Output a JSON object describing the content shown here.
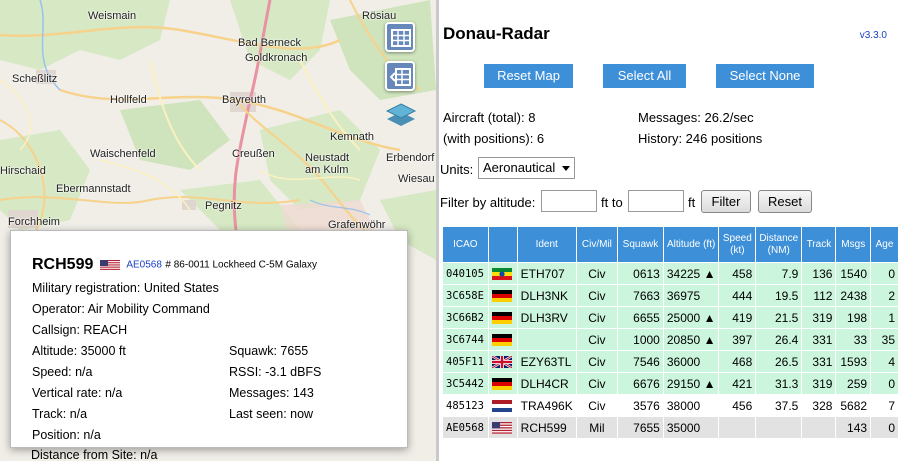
{
  "map": {
    "places": [
      "Weismain",
      "Rösiau",
      "Bad Berneck",
      "Goldkronach",
      "Scheßlitz",
      "Hollfeld",
      "Bayreuth",
      "Kemnath",
      "Waischenfeld",
      "Creußen",
      "Neustadt am Kulm",
      "Erbendorf",
      "Hirschaid",
      "Ebermannstadt",
      "Pegnitz",
      "Wiesau",
      "Forchheim",
      "Grafenwöhr"
    ]
  },
  "popup": {
    "callsign": "RCH599",
    "icao": "AE0568",
    "registration_line": "# 86-0011 Lockheed C-5M Galaxy",
    "military_registration": "Military registration: United States",
    "operator": "Operator: Air Mobility Command",
    "callsign_line": "Callsign: REACH",
    "altitude": "Altitude: 35000 ft",
    "squawk": "Squawk: 7655",
    "speed": "Speed: n/a",
    "rssi": "RSSI: -3.1 dBFS",
    "vertical_rate": "Vertical rate: n/a",
    "messages": "Messages: 143",
    "track": "Track: n/a",
    "last_seen": "Last seen: now",
    "position": "Position: n/a",
    "distance": "Distance from Site: n/a"
  },
  "sidebar": {
    "title": "Donau-Radar",
    "version": "v3.3.0",
    "buttons": {
      "reset_map": "Reset Map",
      "select_all": "Select All",
      "select_none": "Select None"
    },
    "aircraft_total": "Aircraft (total): 8",
    "with_positions": "(with positions): 6",
    "messages": "Messages: 26.2/sec",
    "history": "History: 246 positions",
    "units_label": "Units:",
    "units_value": "Aeronautical",
    "filter_label": "Filter by altitude:",
    "ft_to": "ft to",
    "ft": "ft",
    "filter_button": "Filter",
    "reset_button": "Reset"
  },
  "table": {
    "headers": [
      "ICAO",
      "",
      "Ident",
      "Civ/Mil",
      "Squawk",
      "Altitude (ft)",
      "Speed (kt)",
      "Distance (NM)",
      "Track",
      "Msgs",
      "Age"
    ],
    "rows": [
      {
        "icao": "040105",
        "flag": "ethiopia",
        "ident": "ETH707",
        "civmil": "Civ",
        "squawk": "0613",
        "altitude": "34225 ▲",
        "speed": "458",
        "distance": "7.9",
        "track": "136",
        "msgs": "1540",
        "age": "0",
        "kind": "pos"
      },
      {
        "icao": "3C658E",
        "flag": "germany",
        "ident": "DLH3NK",
        "civmil": "Civ",
        "squawk": "7663",
        "altitude": "36975",
        "speed": "444",
        "distance": "19.5",
        "track": "112",
        "msgs": "2438",
        "age": "2",
        "kind": "pos"
      },
      {
        "icao": "3C66B2",
        "flag": "germany",
        "ident": "DLH3RV",
        "civmil": "Civ",
        "squawk": "6655",
        "altitude": "25000 ▲",
        "speed": "419",
        "distance": "21.5",
        "track": "319",
        "msgs": "198",
        "age": "1",
        "kind": "pos"
      },
      {
        "icao": "3C6744",
        "flag": "germany",
        "ident": "",
        "civmil": "Civ",
        "squawk": "1000",
        "altitude": "20850 ▲",
        "speed": "397",
        "distance": "26.4",
        "track": "331",
        "msgs": "33",
        "age": "35",
        "kind": "pos"
      },
      {
        "icao": "405F11",
        "flag": "uk",
        "ident": "EZY63TL",
        "civmil": "Civ",
        "squawk": "7546",
        "altitude": "36000",
        "speed": "468",
        "distance": "26.5",
        "track": "331",
        "msgs": "1593",
        "age": "4",
        "kind": "pos"
      },
      {
        "icao": "3C5442",
        "flag": "germany",
        "ident": "DLH4CR",
        "civmil": "Civ",
        "squawk": "6676",
        "altitude": "29150 ▲",
        "speed": "421",
        "distance": "31.3",
        "track": "319",
        "msgs": "259",
        "age": "0",
        "kind": "pos"
      },
      {
        "icao": "485123",
        "flag": "netherlands",
        "ident": "TRA496K",
        "civmil": "Civ",
        "squawk": "3576",
        "altitude": "38000",
        "speed": "456",
        "distance": "37.5",
        "track": "328",
        "msgs": "5682",
        "age": "7",
        "kind": "nopos"
      },
      {
        "icao": "AE0568",
        "flag": "usa",
        "ident": "RCH599",
        "civmil": "Mil",
        "squawk": "7655",
        "altitude": "35000",
        "speed": "",
        "distance": "",
        "track": "",
        "msgs": "143",
        "age": "0",
        "kind": "mil"
      }
    ]
  }
}
